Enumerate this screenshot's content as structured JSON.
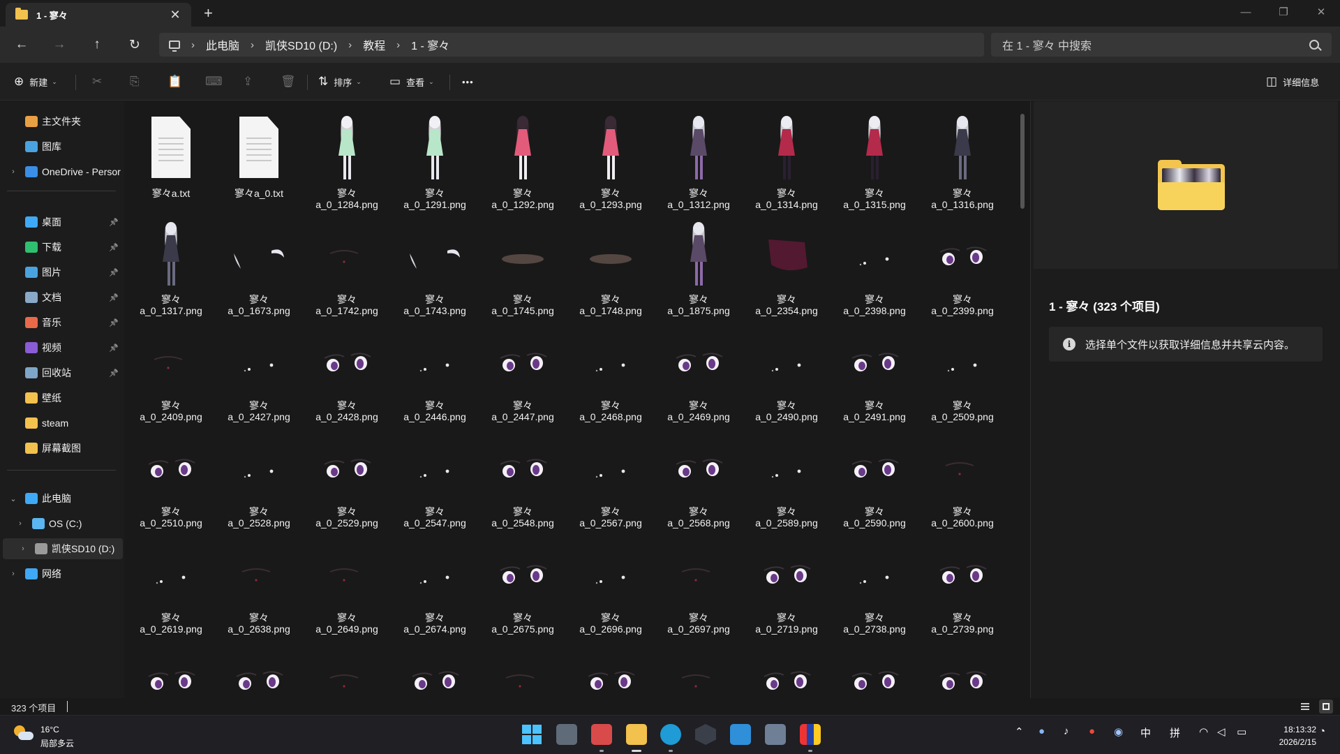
{
  "tab": {
    "title": "1 - 寥々",
    "close": "✕",
    "new": "+"
  },
  "window_controls": {
    "minimize": "—",
    "restore": "❐",
    "close": "✕"
  },
  "nav": {
    "back": "←",
    "forward": "→",
    "up": "↑",
    "refresh": "↻"
  },
  "breadcrumb": [
    "此电脑",
    "凯侠SD10 (D:)",
    "教程",
    "1 - 寥々"
  ],
  "search": {
    "placeholder": "在 1 - 寥々 中搜索"
  },
  "commands": {
    "new": "新建",
    "cut_icon": "✂",
    "copy_icon": "⎘",
    "paste_icon": "📋",
    "rename_icon": "⌨",
    "share_icon": "⇪",
    "delete_icon": "🗑",
    "sort": "排序",
    "view": "查看",
    "more": "•••",
    "details": "详细信息"
  },
  "sidebar": {
    "quick": [
      {
        "label": "主文件夹",
        "icon": "home-icon",
        "color": "#e8a045"
      },
      {
        "label": "图库",
        "icon": "gallery-icon",
        "color": "#4aa3df"
      },
      {
        "label": "OneDrive - Persor",
        "icon": "onedrive-icon",
        "color": "#3a8ee6"
      }
    ],
    "pinned": [
      {
        "label": "桌面",
        "icon": "desktop-icon",
        "color": "#3fa9f5"
      },
      {
        "label": "下载",
        "icon": "download-icon",
        "color": "#2fbf71"
      },
      {
        "label": "图片",
        "icon": "pictures-icon",
        "color": "#4aa3df"
      },
      {
        "label": "文档",
        "icon": "documents-icon",
        "color": "#8aa8c8"
      },
      {
        "label": "音乐",
        "icon": "music-icon",
        "color": "#e86a4a"
      },
      {
        "label": "视频",
        "icon": "videos-icon",
        "color": "#8a5cd6"
      },
      {
        "label": "回收站",
        "icon": "recycle-bin-icon",
        "color": "#7fa6c8"
      },
      {
        "label": "壁纸",
        "icon": "folder-icon",
        "color": "#f2c14e"
      },
      {
        "label": "steam",
        "icon": "folder-icon",
        "color": "#f2c14e"
      },
      {
        "label": "屏幕截图",
        "icon": "folder-icon",
        "color": "#f2c14e"
      }
    ],
    "tree": [
      {
        "label": "此电脑",
        "icon": "this-pc-icon",
        "color": "#3fa9f5"
      },
      {
        "label": "OS (C:)",
        "icon": "drive-icon",
        "color": "#5bb5f0"
      },
      {
        "label": "凯侠SD10 (D:)",
        "icon": "drive-icon",
        "color": "#9a9a9a"
      },
      {
        "label": "网络",
        "icon": "network-icon",
        "color": "#3fa9f5"
      }
    ]
  },
  "files": [
    {
      "name": "寥々a.txt",
      "kind": "txt"
    },
    {
      "name": "寥々a_0.txt",
      "kind": "txt"
    },
    {
      "name": "寥々\na_0_1284.png",
      "kind": "figure",
      "palette": "mint"
    },
    {
      "name": "寥々\na_0_1291.png",
      "kind": "figure",
      "palette": "mint"
    },
    {
      "name": "寥々\na_0_1292.png",
      "kind": "figure",
      "palette": "witch"
    },
    {
      "name": "寥々\na_0_1293.png",
      "kind": "figure",
      "palette": "witch"
    },
    {
      "name": "寥々\na_0_1312.png",
      "kind": "figure",
      "palette": "purple"
    },
    {
      "name": "寥々\na_0_1314.png",
      "kind": "figure",
      "palette": "red"
    },
    {
      "name": "寥々\na_0_1315.png",
      "kind": "figure",
      "palette": "red"
    },
    {
      "name": "寥々\na_0_1316.png",
      "kind": "figure",
      "palette": "dark"
    },
    {
      "name": "寥々\na_0_1317.png",
      "kind": "figure",
      "palette": "dark"
    },
    {
      "name": "寥々\na_0_1673.png",
      "kind": "hair"
    },
    {
      "name": "寥々\na_0_1742.png",
      "kind": "faint"
    },
    {
      "name": "寥々\na_0_1743.png",
      "kind": "hair"
    },
    {
      "name": "寥々\na_0_1745.png",
      "kind": "blush"
    },
    {
      "name": "寥々\na_0_1748.png",
      "kind": "blush"
    },
    {
      "name": "寥々\na_0_1875.png",
      "kind": "figure",
      "palette": "purple"
    },
    {
      "name": "寥々\na_0_2354.png",
      "kind": "cloth"
    },
    {
      "name": "寥々\na_0_2398.png",
      "kind": "dots"
    },
    {
      "name": "寥々\na_0_2399.png",
      "kind": "eyes"
    },
    {
      "name": "寥々\na_0_2409.png",
      "kind": "faint"
    },
    {
      "name": "寥々\na_0_2427.png",
      "kind": "dots"
    },
    {
      "name": "寥々\na_0_2428.png",
      "kind": "eyes"
    },
    {
      "name": "寥々\na_0_2446.png",
      "kind": "dots"
    },
    {
      "name": "寥々\na_0_2447.png",
      "kind": "eyes"
    },
    {
      "name": "寥々\na_0_2468.png",
      "kind": "dots"
    },
    {
      "name": "寥々\na_0_2469.png",
      "kind": "eyes"
    },
    {
      "name": "寥々\na_0_2490.png",
      "kind": "dots"
    },
    {
      "name": "寥々\na_0_2491.png",
      "kind": "eyes"
    },
    {
      "name": "寥々\na_0_2509.png",
      "kind": "dots"
    },
    {
      "name": "寥々\na_0_2510.png",
      "kind": "eyes"
    },
    {
      "name": "寥々\na_0_2528.png",
      "kind": "dots"
    },
    {
      "name": "寥々\na_0_2529.png",
      "kind": "eyes"
    },
    {
      "name": "寥々\na_0_2547.png",
      "kind": "dots"
    },
    {
      "name": "寥々\na_0_2548.png",
      "kind": "eyes"
    },
    {
      "name": "寥々\na_0_2567.png",
      "kind": "dots"
    },
    {
      "name": "寥々\na_0_2568.png",
      "kind": "eyes"
    },
    {
      "name": "寥々\na_0_2589.png",
      "kind": "dots"
    },
    {
      "name": "寥々\na_0_2590.png",
      "kind": "eyes"
    },
    {
      "name": "寥々\na_0_2600.png",
      "kind": "faint"
    },
    {
      "name": "寥々\na_0_2619.png",
      "kind": "dots"
    },
    {
      "name": "寥々\na_0_2638.png",
      "kind": "faint"
    },
    {
      "name": "寥々\na_0_2649.png",
      "kind": "faint"
    },
    {
      "name": "寥々\na_0_2674.png",
      "kind": "dots"
    },
    {
      "name": "寥々\na_0_2675.png",
      "kind": "eyes"
    },
    {
      "name": "寥々\na_0_2696.png",
      "kind": "dots"
    },
    {
      "name": "寥々\na_0_2697.png",
      "kind": "faint"
    },
    {
      "name": "寥々\na_0_2719.png",
      "kind": "eyes"
    },
    {
      "name": "寥々\na_0_2738.png",
      "kind": "dots"
    },
    {
      "name": "寥々\na_0_2739.png",
      "kind": "eyes"
    },
    {
      "name": "",
      "kind": "eyes"
    },
    {
      "name": "",
      "kind": "eyes"
    },
    {
      "name": "",
      "kind": "faint"
    },
    {
      "name": "",
      "kind": "eyes"
    },
    {
      "name": "",
      "kind": "faint"
    },
    {
      "name": "",
      "kind": "eyes"
    },
    {
      "name": "",
      "kind": "faint"
    },
    {
      "name": "",
      "kind": "eyes"
    },
    {
      "name": "",
      "kind": "eyes"
    },
    {
      "name": "",
      "kind": "eyes"
    }
  ],
  "details_pane": {
    "title": "1 - 寥々 (323 个项目)",
    "info": "选择单个文件以获取详细信息并共享云内容。"
  },
  "status": {
    "count": "323 个项目"
  },
  "taskbar": {
    "weather_temp": "16°C",
    "weather_desc": "局部多云",
    "tray_ime1": "中",
    "tray_ime2": "拼",
    "time": "18:13:32",
    "date": "2026/2/15"
  }
}
